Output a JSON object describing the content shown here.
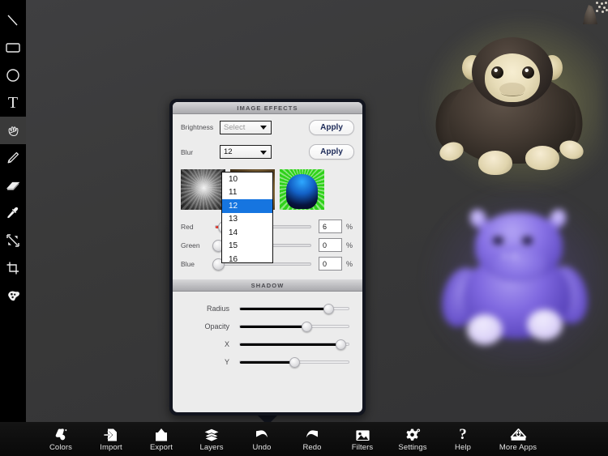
{
  "app": {
    "canvas_bg": "#3a3a3c",
    "sidebar_bg": "#000000",
    "accent": "#1675e0"
  },
  "tool_sidebar": {
    "items": [
      {
        "name": "line-tool",
        "icon": "line-icon",
        "glyph": "\\",
        "active": false
      },
      {
        "name": "rectangle-tool",
        "icon": "rectangle-icon",
        "glyph": "",
        "active": false
      },
      {
        "name": "ellipse-tool",
        "icon": "ellipse-icon",
        "glyph": "",
        "active": false
      },
      {
        "name": "text-tool",
        "icon": "text-icon",
        "glyph": "T",
        "active": false
      },
      {
        "name": "hand-tool",
        "icon": "hand-icon",
        "glyph": "",
        "active": true
      },
      {
        "name": "pencil-tool",
        "icon": "pencil-icon",
        "glyph": "",
        "active": false
      },
      {
        "name": "eraser-tool",
        "icon": "eraser-icon",
        "glyph": "",
        "active": false
      },
      {
        "name": "eyedropper-tool",
        "icon": "eyedropper-icon",
        "glyph": "",
        "active": false
      },
      {
        "name": "resize-tool",
        "icon": "expand-arrows-icon",
        "glyph": "",
        "active": false
      },
      {
        "name": "crop-tool",
        "icon": "crop-icon",
        "glyph": "",
        "active": false
      },
      {
        "name": "clone-tool",
        "icon": "blob-clone-icon",
        "glyph": "",
        "active": false
      }
    ]
  },
  "bottom_toolbar": {
    "items": [
      {
        "label": "Colors",
        "icon": "paint-bucket-icon"
      },
      {
        "label": "Import",
        "icon": "import-arrow-icon"
      },
      {
        "label": "Export",
        "icon": "export-arrow-icon"
      },
      {
        "label": "Layers",
        "icon": "layers-stack-icon"
      },
      {
        "label": "Undo",
        "icon": "undo-arrow-icon"
      },
      {
        "label": "Redo",
        "icon": "redo-arrow-icon"
      },
      {
        "label": "Filters",
        "icon": "picture-icon"
      },
      {
        "label": "Settings",
        "icon": "gear-icon"
      },
      {
        "label": "Help",
        "icon": "question-mark-icon"
      },
      {
        "label": "More Apps",
        "icon": "app-download-icon"
      }
    ]
  },
  "popover": {
    "image_effects": {
      "title": "IMAGE EFFECTS",
      "brightness": {
        "label": "Brightness",
        "select_value": "Select",
        "is_placeholder": true,
        "apply_label": "Apply"
      },
      "blur": {
        "label": "Blur",
        "select_value": "12",
        "is_placeholder": false,
        "apply_label": "Apply",
        "dropdown_open": true,
        "options": [
          "10",
          "11",
          "12",
          "13",
          "14",
          "15",
          "16"
        ],
        "selected_option": "12"
      },
      "thumbnails": [
        {
          "name": "filter-thumb-grayscale",
          "style": "t-gray"
        },
        {
          "name": "filter-thumb-sepia",
          "style": "t-sepia"
        },
        {
          "name": "filter-thumb-popart",
          "style": "t-pop"
        }
      ],
      "color_sliders": [
        {
          "label": "Red",
          "value": "6",
          "unit": "%",
          "percent": 6,
          "fill_color": "#e03a2f"
        },
        {
          "label": "Green",
          "value": "0",
          "unit": "%",
          "percent": 0,
          "fill_color": "#2fa83a"
        },
        {
          "label": "Blue",
          "value": "0",
          "unit": "%",
          "percent": 0,
          "fill_color": "#2f5ae0"
        }
      ]
    },
    "shadow": {
      "title": "SHADOW",
      "sliders": [
        {
          "label": "Radius",
          "percent": 78
        },
        {
          "label": "Opacity",
          "percent": 58
        },
        {
          "label": "X",
          "percent": 89
        },
        {
          "label": "Y",
          "percent": 47
        }
      ]
    }
  },
  "canvas": {
    "images": [
      {
        "name": "chimp-plush-image",
        "alt": "brown plush chimpanzee with yellow glow shadow"
      },
      {
        "name": "hippo-plush-image",
        "alt": "purple plush hippo, blurred"
      }
    ],
    "corner_thumbnail": {
      "name": "corner-image-thumbnail"
    }
  }
}
